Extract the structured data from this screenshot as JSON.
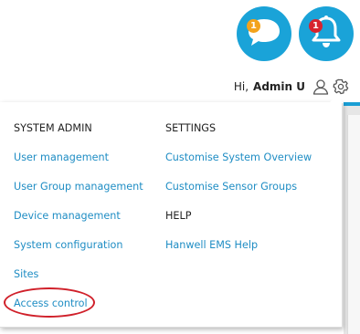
{
  "notifications": {
    "chat_badge_count": "1",
    "bell_badge_count": "1",
    "colors": {
      "button_bg": "#1aa3d8",
      "chat_badge": "#f3a31c",
      "bell_badge": "#d7232e"
    }
  },
  "user": {
    "greeting": "Hi,",
    "name": "Admin U",
    "user_icon": "user-icon",
    "settings_icon": "gear-icon"
  },
  "menu": {
    "system_admin": {
      "heading": "SYSTEM ADMIN",
      "items": [
        {
          "label": "User management"
        },
        {
          "label": "User Group management"
        },
        {
          "label": "Device management"
        },
        {
          "label": "System configuration"
        },
        {
          "label": "Sites"
        },
        {
          "label": "Access control"
        }
      ]
    },
    "settings": {
      "heading": "SETTINGS",
      "items": [
        {
          "label": "Customise System Overview"
        },
        {
          "label": "Customise Sensor Groups"
        }
      ]
    },
    "help": {
      "heading": "HELP",
      "items": [
        {
          "label": "Hanwell EMS Help"
        }
      ]
    },
    "colors": {
      "link": "#1f8dc4",
      "heading": "#222222",
      "highlight_oval": "#d0202a"
    }
  }
}
